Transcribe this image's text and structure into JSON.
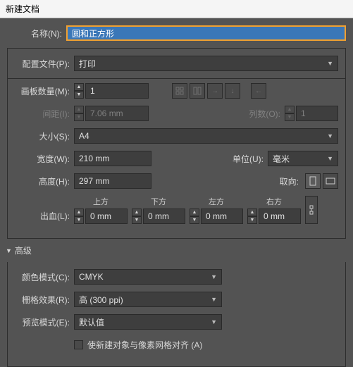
{
  "window": {
    "title": "新建文档"
  },
  "name": {
    "label": "名称(N):",
    "value": "圆和正方形"
  },
  "profile": {
    "label": "配置文件(P):",
    "value": "打印"
  },
  "artboards": {
    "label": "画板数量(M):",
    "value": "1"
  },
  "spacing": {
    "label": "间距(I):",
    "value": "7.06 mm"
  },
  "columns": {
    "label": "列数(O):",
    "value": "1"
  },
  "size": {
    "label": "大小(S):",
    "value": "A4"
  },
  "width": {
    "label": "宽度(W):",
    "value": "210 mm"
  },
  "height": {
    "label": "高度(H):",
    "value": "297 mm"
  },
  "units": {
    "label": "单位(U):",
    "value": "毫米"
  },
  "orient": {
    "label": "取向:"
  },
  "bleed": {
    "label": "出血(L):",
    "top": {
      "h": "上方",
      "value": "0 mm"
    },
    "bottom": {
      "h": "下方",
      "value": "0 mm"
    },
    "left": {
      "h": "左方",
      "value": "0 mm"
    },
    "right": {
      "h": "右方",
      "value": "0 mm"
    }
  },
  "advanced": {
    "label": "高级"
  },
  "colormode": {
    "label": "颜色模式(C):",
    "value": "CMYK"
  },
  "raster": {
    "label": "栅格效果(R):",
    "value": "高 (300 ppi)"
  },
  "preview": {
    "label": "预览模式(E):",
    "value": "默认值"
  },
  "align": {
    "label": "使新建对象与像素网格对齐 (A)"
  }
}
